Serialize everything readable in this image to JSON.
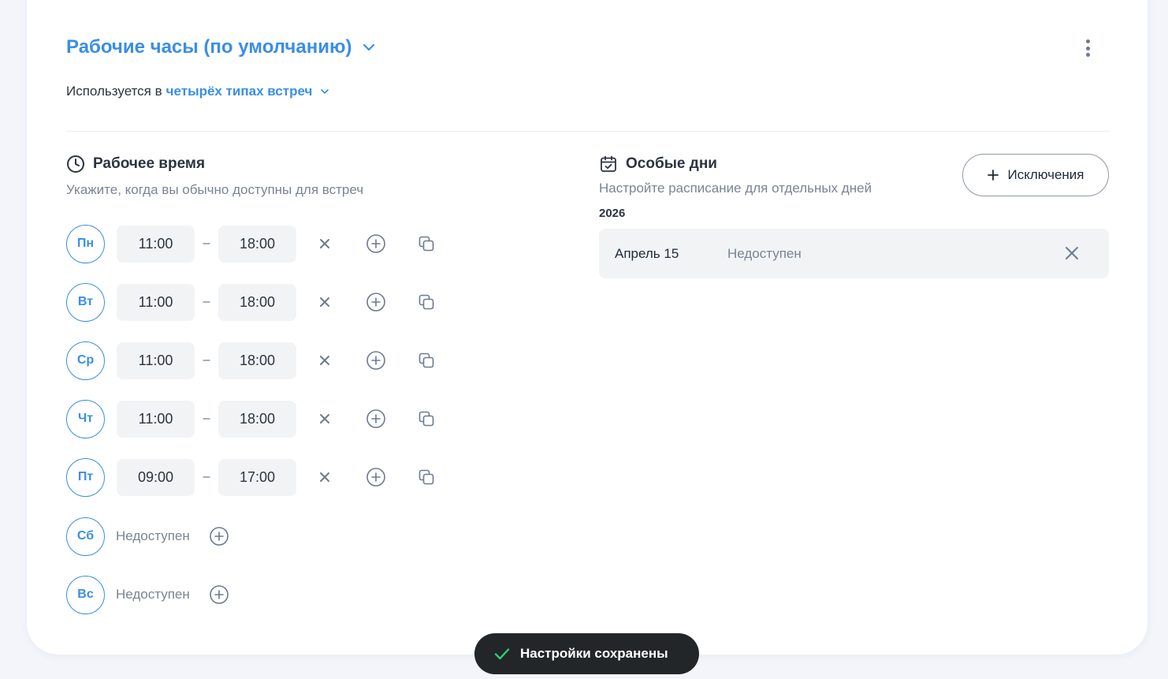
{
  "schedule": {
    "title": "Рабочие часы (по умолчанию)",
    "usage_prefix": "Используется в",
    "usage_link": "четырёх типах встреч"
  },
  "working_hours": {
    "title": "Рабочее время",
    "subtitle": "Укажите, когда вы обычно доступны для встреч",
    "days": [
      {
        "label": "Пн",
        "start": "11:00",
        "end": "18:00",
        "available": true
      },
      {
        "label": "Вт",
        "start": "11:00",
        "end": "18:00",
        "available": true
      },
      {
        "label": "Ср",
        "start": "11:00",
        "end": "18:00",
        "available": true
      },
      {
        "label": "Чт",
        "start": "11:00",
        "end": "18:00",
        "available": true
      },
      {
        "label": "Пт",
        "start": "09:00",
        "end": "17:00",
        "available": true
      },
      {
        "label": "Сб",
        "status": "Недоступен",
        "available": false
      },
      {
        "label": "Вс",
        "status": "Недоступен",
        "available": false
      }
    ],
    "separator": "–"
  },
  "special_days": {
    "title": "Особые дни",
    "subtitle": "Настройте расписание для отдельных дней",
    "add_button": "Исключения",
    "year": "2026",
    "items": [
      {
        "date": "Апрель 15",
        "status": "Недоступен"
      }
    ]
  },
  "toast": {
    "message": "Настройки сохранены"
  },
  "icons": {
    "title_dropdown": "chevron-down-icon",
    "more": "kebab-menu-icon",
    "clock": "clock-icon",
    "calendar": "calendar-check-icon",
    "remove": "close-icon",
    "add": "plus-circle-icon",
    "copy": "copy-icon",
    "check": "check-icon"
  },
  "colors": {
    "accent": "#3a8ee6",
    "toast_bg": "#222629",
    "toast_check": "#2ecc71",
    "surface": "#f1f3f5"
  }
}
